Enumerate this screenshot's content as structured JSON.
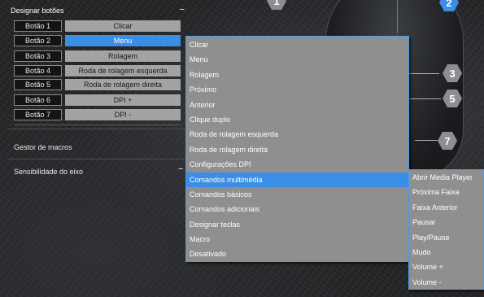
{
  "callouts": {
    "numbers": [
      "1",
      "2",
      "3",
      "5",
      "7"
    ]
  },
  "panel": {
    "assign_header": "Designar botões",
    "collapse_symbol": "−",
    "buttons": [
      {
        "label": "Botão 1",
        "value": "Clicar"
      },
      {
        "label": "Botão 2",
        "value": "Menu"
      },
      {
        "label": "Botão 3",
        "value": "Rolagem"
      },
      {
        "label": "Botão 4",
        "value": "Roda de rolagem esquerda"
      },
      {
        "label": "Botão 5",
        "value": "Roda de rolagem direita"
      },
      {
        "label": "Botão 6",
        "value": "DPI +"
      },
      {
        "label": "Botão 7",
        "value": "DPI -"
      }
    ],
    "selected_button_index": 1,
    "macro_manager": "Gestor de macros",
    "axis_sensitivity": "Sensibilidade do eixo",
    "axis_collapse_symbol": "−"
  },
  "main_menu": {
    "items": [
      "Clicar",
      "Menu",
      "Rolagem",
      "Próximo",
      "Anterior",
      "Clique duplo",
      "Roda de rolagem esquerda",
      "Roda de rolagem direita",
      "Configurações DPI",
      "Comandos multimédia",
      "Comandos básicos",
      "Comandos adicionais",
      "Designar teclas",
      "Macro",
      "Desativado"
    ],
    "active_index": 9
  },
  "sub_menu": {
    "items": [
      "Abrir Media Player",
      "Próxima Faixa",
      "Faixa Anterior",
      "Pausar",
      "Play/Pause",
      "Mudo",
      "Volume +",
      "Volume -"
    ]
  },
  "colors": {
    "accent": "#3a8ee6",
    "menu_bg": "#8f8f8f",
    "value_bg": "#a3a3a3"
  }
}
